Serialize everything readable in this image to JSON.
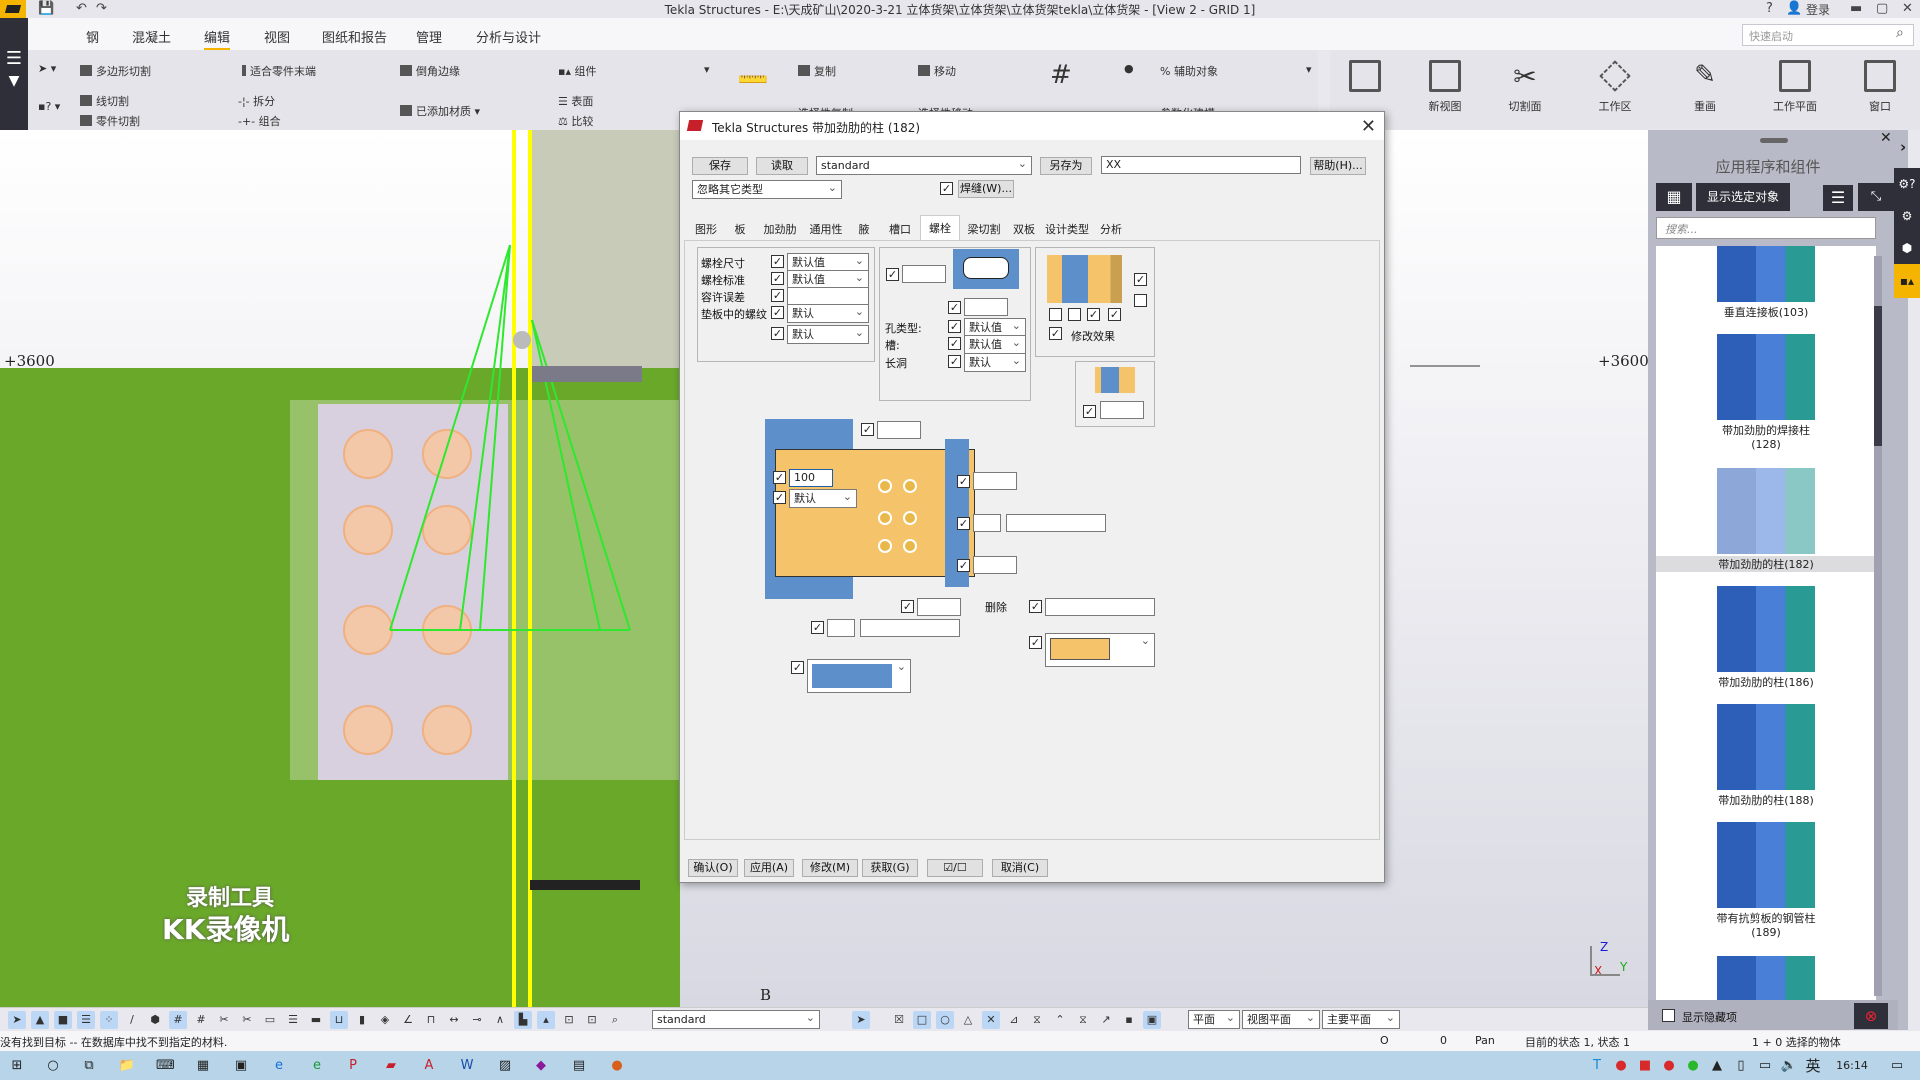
{
  "window": {
    "title": "Tekla Structures - E:\\天成矿山\\2020-3-21 立体货架\\立体货架\\立体货架tekla\\立体货架  - [View 2 - GRID 1]",
    "help": "?",
    "login": "登录",
    "quick_launch_placeholder": "快速启动"
  },
  "menu": {
    "items": [
      "钢",
      "混凝土",
      "编辑",
      "视图",
      "图纸和报告",
      "管理",
      "分析与设计"
    ],
    "active": "编辑"
  },
  "ribbon": {
    "col1": [
      "多边形切割",
      "线切割",
      "零件切割"
    ],
    "col2": [
      "适合零件末端",
      "拆分",
      "组合"
    ],
    "col3": [
      "倒角边缘",
      "已添加材质"
    ],
    "col4": [
      "组件",
      "表面",
      "比较"
    ],
    "col5": [
      "复制",
      "选择性复制"
    ],
    "col6": [
      "移动",
      "选择性移动"
    ],
    "col7": [
      "辅助对象",
      "参数化建模"
    ],
    "big_buttons": [
      "",
      "新视图",
      "切割面",
      "工作区",
      "重画",
      "工作平面",
      "窗口"
    ]
  },
  "viewport": {
    "grid_label_left": "+3600",
    "grid_label_right": "+3600",
    "grid_label_bottom": "B",
    "watermark_line1": "录制工具",
    "watermark_line2": "KK录像机",
    "axis": {
      "z": "Z",
      "x": "X",
      "y": "Y"
    }
  },
  "dialog": {
    "title": "Tekla Structures  带加劲肋的柱 (182)",
    "save": "保存",
    "load": "读取",
    "preset": "standard",
    "save_as": "另存为",
    "save_as_name": "XX",
    "help": "帮助(H)...",
    "type_filter": "忽略其它类型",
    "weld_checked": true,
    "weld": "焊缝(W)...",
    "tabs": [
      "图形",
      "板",
      "加劲肋",
      "通用性",
      "腋",
      "槽口",
      "螺栓",
      "梁切割",
      "双板",
      "设计类型",
      "分析"
    ],
    "active_tab": "螺栓",
    "bolt_props": [
      {
        "label": "螺栓尺寸",
        "checked": true,
        "value": "默认值"
      },
      {
        "label": "螺栓标准",
        "checked": true,
        "value": "默认值"
      },
      {
        "label": "容许误差",
        "checked": true,
        "value": ""
      },
      {
        "label": "垫板中的螺纹",
        "checked": true,
        "value": "默认"
      },
      {
        "label": "",
        "checked": true,
        "value": "默认"
      }
    ],
    "hole_props": [
      {
        "label": "孔类型:",
        "checked": true,
        "value": "默认值"
      },
      {
        "label": "槽:",
        "checked": true,
        "value": "默认值"
      },
      {
        "label": "长洞",
        "checked": true,
        "value": "默认"
      }
    ],
    "modify_effect": "修改效果",
    "edge_distance": "100",
    "edge_option": "默认",
    "delete_label": "删除",
    "footer": {
      "ok": "确认(O)",
      "apply": "应用(A)",
      "modify": "修改(M)",
      "get": "获取(G)",
      "toggle": "☑/☐",
      "cancel": "取消(C)"
    }
  },
  "panel": {
    "title": "应用程序和组件",
    "show_selected": "显示选定对象",
    "search_placeholder": "搜索...",
    "components": [
      {
        "name": "垂直连接板(103)",
        "selected": false
      },
      {
        "name": "带加劲肋的焊接柱\n(128)",
        "selected": false
      },
      {
        "name": "带加劲肋的柱(182)",
        "selected": true
      },
      {
        "name": "带加劲肋的柱(186)",
        "selected": false
      },
      {
        "name": "带加劲肋的柱(188)",
        "selected": false
      },
      {
        "name": "带有抗剪板的钢管柱\n(189)",
        "selected": false
      }
    ],
    "show_hidden": "显示隐藏项"
  },
  "bottom_toolbar": {
    "filter": "standard",
    "plane1": "平面",
    "plane2": "视图平面",
    "plane3": "主要平面"
  },
  "status": {
    "message": "没有找到目标 -- 在数据库中找不到指定的材料.",
    "o": "O",
    "zero": "0",
    "mode": "Pan",
    "state": "目前的状态 1, 状态 1",
    "selection": "1 + 0 选择的物体"
  },
  "taskbar": {
    "ime": "英",
    "time": "16:14"
  }
}
